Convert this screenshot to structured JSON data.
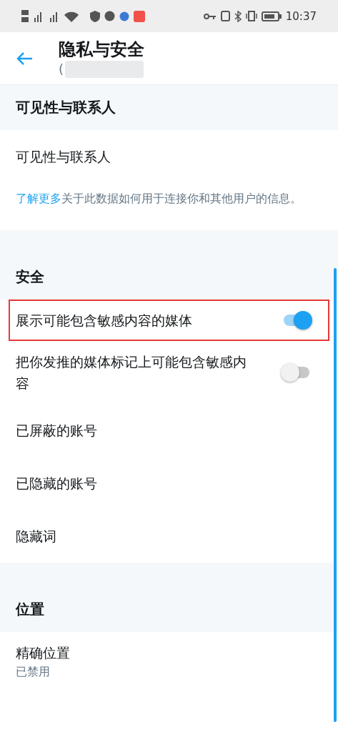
{
  "status_bar": {
    "time": "10:37"
  },
  "header": {
    "title": "隐私与安全",
    "subtitle": "("
  },
  "sections": [
    {
      "title": "可见性与联系人",
      "items": [
        {
          "kind": "link",
          "label": "可见性与联系人"
        },
        {
          "kind": "info",
          "text": "关于此数据如何用于连接你和其他用户的信息。",
          "link": "了解更多"
        }
      ]
    },
    {
      "title": "安全",
      "items": [
        {
          "kind": "toggle",
          "label": "展示可能包含敏感内容的媒体",
          "on": true,
          "highlighted": true
        },
        {
          "kind": "toggle",
          "label": "把你发推的媒体标记上可能包含敏感内容",
          "on": false,
          "highlighted": false
        },
        {
          "kind": "link",
          "label": "已屏蔽的账号"
        },
        {
          "kind": "link",
          "label": "已隐藏的账号"
        },
        {
          "kind": "link",
          "label": "隐藏词"
        }
      ]
    },
    {
      "title": "位置",
      "items": [
        {
          "kind": "detail",
          "label": "精确位置",
          "value": "已禁用"
        }
      ]
    }
  ]
}
